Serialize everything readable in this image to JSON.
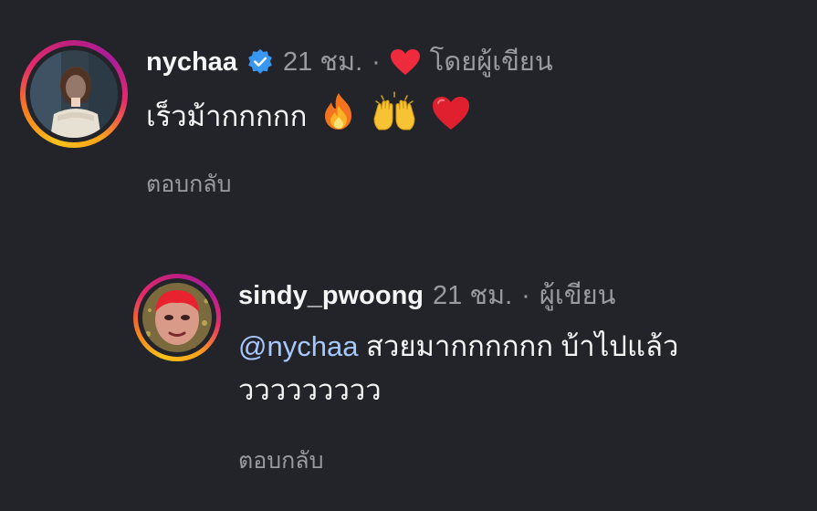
{
  "comments": [
    {
      "username": "nychaa",
      "time": "21 ชม.",
      "separator": "·",
      "by_author": "โดยผู้เขียน",
      "text": "เร็วม้ากกกกก",
      "emojis": [
        "fire-icon",
        "raising-hands-icon",
        "red-heart-icon"
      ],
      "reply_label": "ตอบกลับ"
    },
    {
      "username": "sindy_pwoong",
      "time": "21 ชม.",
      "separator": "·",
      "author_label": "ผู้เขียน",
      "mention": "@nychaa",
      "text_line1": " สวยมากกกกกก บ้าไปแล้ว",
      "text_line2": "ววววววววว",
      "reply_label": "ตอบกลับ"
    }
  ],
  "colors": {
    "background": "#232429",
    "text": "#f5f5f5",
    "muted": "#9a9ba0",
    "mention": "#a8c7fa",
    "verified": "#3897f0",
    "heart": "#ed2b3d"
  }
}
